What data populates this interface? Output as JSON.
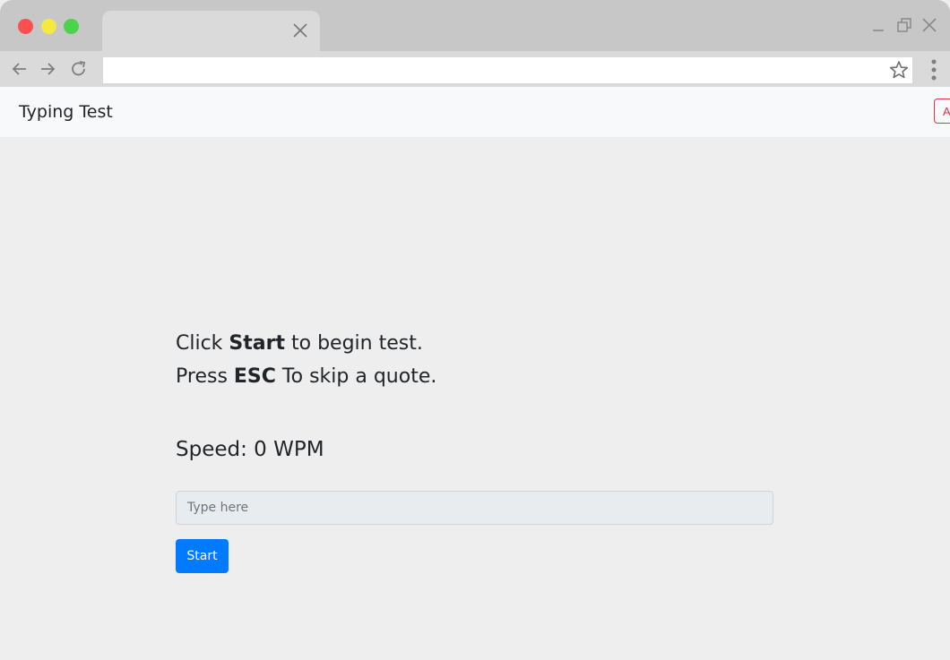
{
  "browser": {
    "address_value": "",
    "icons": [
      "back-arrow-icon",
      "forward-arrow-icon",
      "reload-icon",
      "star-icon",
      "menu-dots-icon",
      "close-icon",
      "minimize-icon",
      "restore-icon"
    ]
  },
  "navbar": {
    "brand": "Typing Test",
    "right_button_label": "A"
  },
  "instructions": {
    "line1_pre": "Click ",
    "line1_bold": "Start",
    "line1_post": " to begin test.",
    "line2_pre": "Press ",
    "line2_bold": "ESC",
    "line2_post": " To skip a quote."
  },
  "speed": {
    "label": "Speed: ",
    "value": "0",
    "unit": " WPM"
  },
  "input": {
    "placeholder": "Type here",
    "value": ""
  },
  "start_button": {
    "label": "Start"
  },
  "colors": {
    "primary": "#007bff",
    "danger": "#dc3545",
    "page_bg": "#eeeeee",
    "navbar_bg": "#f8f9fa"
  }
}
